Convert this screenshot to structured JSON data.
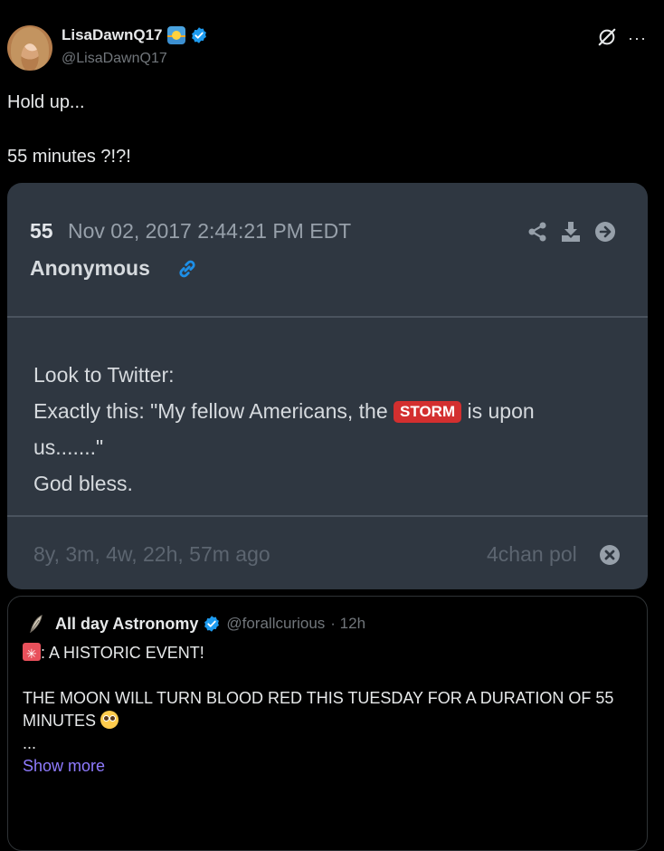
{
  "tweet": {
    "display_name": "LisaDawnQ17",
    "handle": "@LisaDawnQ17",
    "text_line1": "Hold up...",
    "text_line2": "55 minutes ?!?!",
    "name_emoji_icon": "sunrise-icon",
    "verified_icon": "verified-badge-icon",
    "action_icons": [
      "grok-icon",
      "more-icon"
    ],
    "more_label": "···"
  },
  "drop": {
    "number": "55",
    "date": "Nov 02, 2017 2:44:21 PM EDT",
    "author": "Anonymous",
    "body_line1": "Look to Twitter:",
    "body_line2_pre": "Exactly this: \"My fellow Americans, the ",
    "storm_tag": "STORM",
    "body_line2_post": " is upon",
    "body_line3": "us.......\"",
    "body_line4": "God bless.",
    "age": "8y, 3m, 4w, 22h, 57m ago",
    "source": "4chan pol",
    "icons": [
      "link-icon",
      "share-icon",
      "download-icon",
      "arrow-right-icon",
      "close-icon"
    ]
  },
  "quote": {
    "name": "All day Astronomy",
    "handle": "@forallcurious",
    "time": "· 12h",
    "line1": ": A HISTORIC EVENT!",
    "line2": "THE MOON WILL TURN BLOOD RED THIS TUESDAY FOR A DURATION OF 55",
    "line3": "MINUTES",
    "ellipsis": "...",
    "show_more": "Show more",
    "icons": [
      "quill-avatar-icon",
      "siren-emoji-icon",
      "flushed-emoji-icon"
    ]
  },
  "colors": {
    "background": "#000000",
    "card": "#2f3741",
    "storm": "#d32f2f",
    "verified": "#1d9bf0",
    "link": "#8f7bff"
  }
}
